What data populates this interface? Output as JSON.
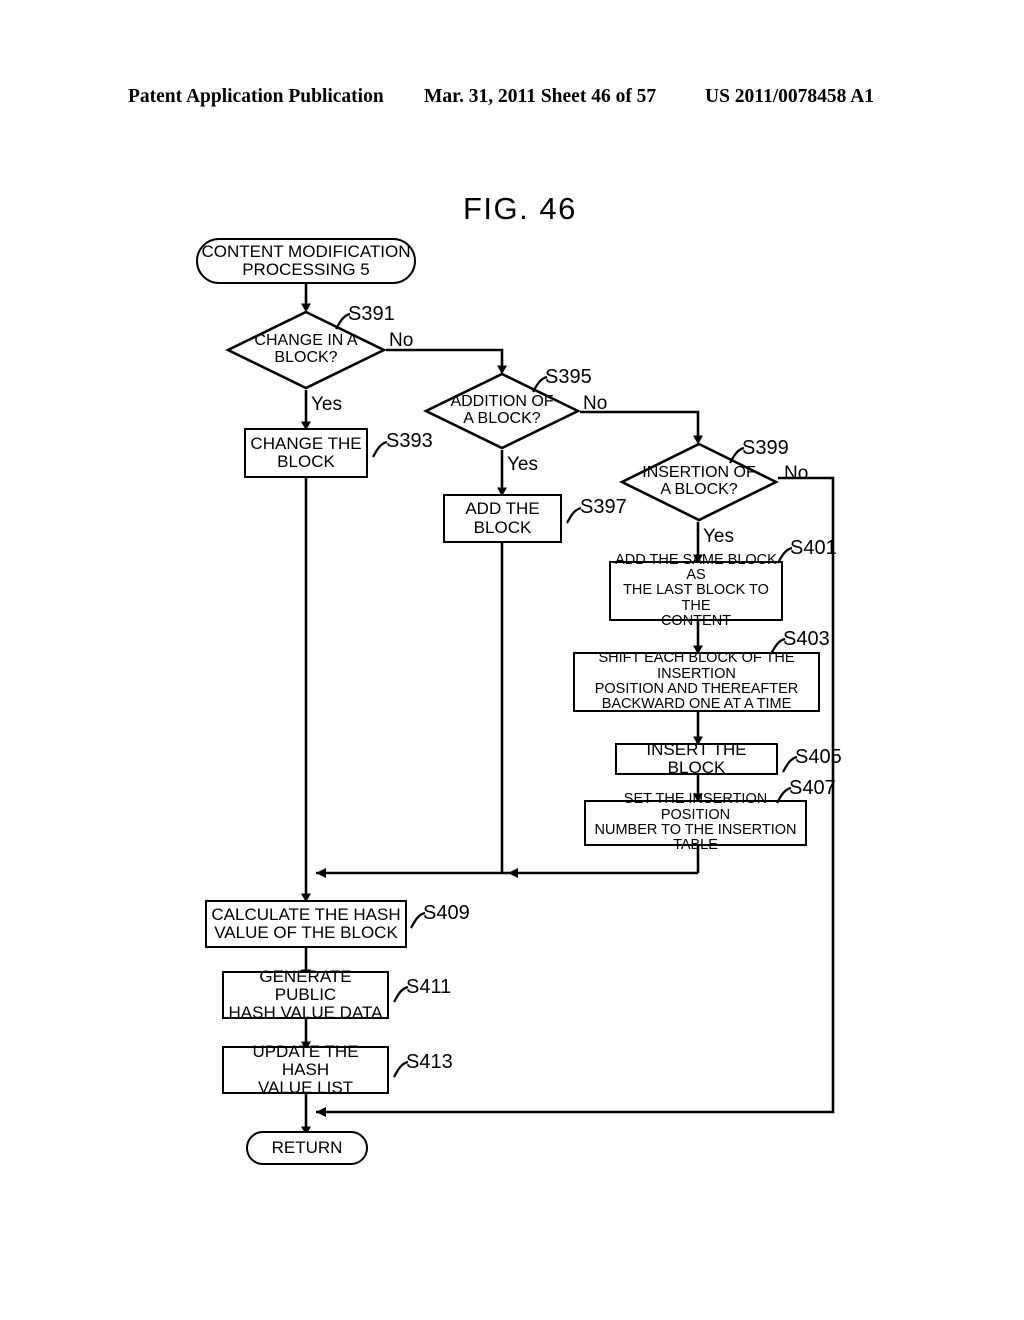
{
  "header": {
    "publication": "Patent Application Publication",
    "date_sheet": "Mar. 31, 2011  Sheet 46 of 57",
    "patent_number": "US 2011/0078458 A1"
  },
  "figure": {
    "title": "FIG.  46"
  },
  "flowchart": {
    "start": {
      "label": "CONTENT MODIFICATION\nPROCESSING 5"
    },
    "end": {
      "label": "RETURN"
    },
    "decisions": [
      {
        "id": "S391",
        "label": "CHANGE IN A\nBLOCK?",
        "step": "S391",
        "yes": "Yes",
        "no": "No"
      },
      {
        "id": "S395",
        "label": "ADDITION OF\nA BLOCK?",
        "step": "S395",
        "yes": "Yes",
        "no": "No"
      },
      {
        "id": "S399",
        "label": "INSERTION OF\nA BLOCK?",
        "step": "S399",
        "yes": "Yes",
        "no": "No"
      }
    ],
    "processes": [
      {
        "id": "S393",
        "label": "CHANGE THE\nBLOCK",
        "step": "S393"
      },
      {
        "id": "S397",
        "label": "ADD THE\nBLOCK",
        "step": "S397"
      },
      {
        "id": "S401",
        "label": "ADD THE SAME BLOCK AS\nTHE LAST BLOCK TO THE\nCONTENT",
        "step": "S401"
      },
      {
        "id": "S403",
        "label": "SHIFT EACH BLOCK OF THE INSERTION\nPOSITION AND THEREAFTER\nBACKWARD ONE AT A TIME",
        "step": "S403"
      },
      {
        "id": "S405",
        "label": "INSERT THE BLOCK",
        "step": "S405"
      },
      {
        "id": "S407",
        "label": "SET THE INSERTION POSITION\nNUMBER TO THE INSERTION TABLE",
        "step": "S407"
      },
      {
        "id": "S409",
        "label": "CALCULATE THE HASH\nVALUE OF THE BLOCK",
        "step": "S409"
      },
      {
        "id": "S411",
        "label": "GENERATE PUBLIC\nHASH VALUE DATA",
        "step": "S411"
      },
      {
        "id": "S413",
        "label": "UPDATE THE HASH\nVALUE LIST",
        "step": "S413"
      }
    ]
  },
  "colors": {
    "ink": "#000000",
    "paper": "#ffffff"
  }
}
